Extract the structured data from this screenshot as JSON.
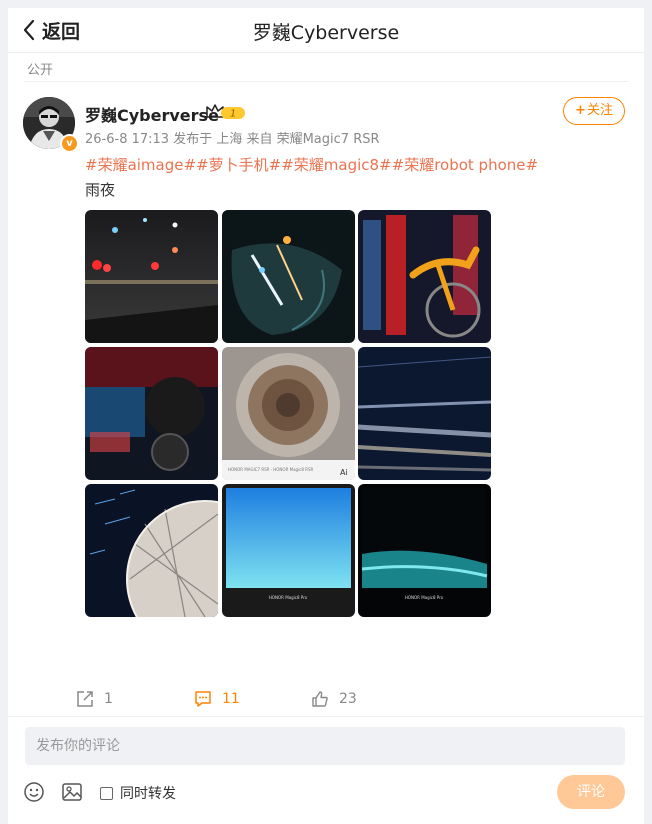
{
  "header": {
    "back_label": "返回",
    "title": "罗巍Cyberverse"
  },
  "visibility": "公开",
  "post": {
    "username": "罗巍Cyberverse",
    "level_badge": "1",
    "verified_badge": "v",
    "meta": "26-6-8 17:13  发布于 上海  来自 荣耀Magic7 RSR",
    "follow_label": "关注",
    "follow_prefix": "+",
    "tags": [
      "#荣耀aimage#",
      "#萝卜手机#",
      "#荣耀magic8#",
      "#荣耀robot phone#"
    ],
    "text": "雨夜",
    "images": [
      {
        "name": "night-street-rain-photo"
      },
      {
        "name": "side-mirror-night-photo"
      },
      {
        "name": "bicycle-rain-photo"
      },
      {
        "name": "rainy-scooter-photo"
      },
      {
        "name": "swirl-abstract-photo",
        "caption": "HONOR MAGIC7 RSR · HONOR Magic8 RSR"
      },
      {
        "name": "blue-light-streaks-photo"
      },
      {
        "name": "dome-structure-night-photo"
      },
      {
        "name": "blue-sky-rain-photo",
        "caption": "HONOR Magic8 Pro"
      },
      {
        "name": "teal-rain-night-photo",
        "caption": "HONOR Magic8 Pro"
      }
    ]
  },
  "actions": {
    "repost_count": "1",
    "comment_count": "11",
    "like_count": "23"
  },
  "composer": {
    "placeholder": "发布你的评论",
    "repost_label": "同时转发",
    "submit_label": "评论"
  },
  "colors": {
    "accent": "#ff8200",
    "tag": "#eb7350",
    "submit_bg": "#ffc896"
  },
  "icons": [
    "chevron-left-icon",
    "crown-icon",
    "share-icon",
    "comment-icon",
    "like-icon",
    "emoji-icon",
    "image-icon"
  ]
}
